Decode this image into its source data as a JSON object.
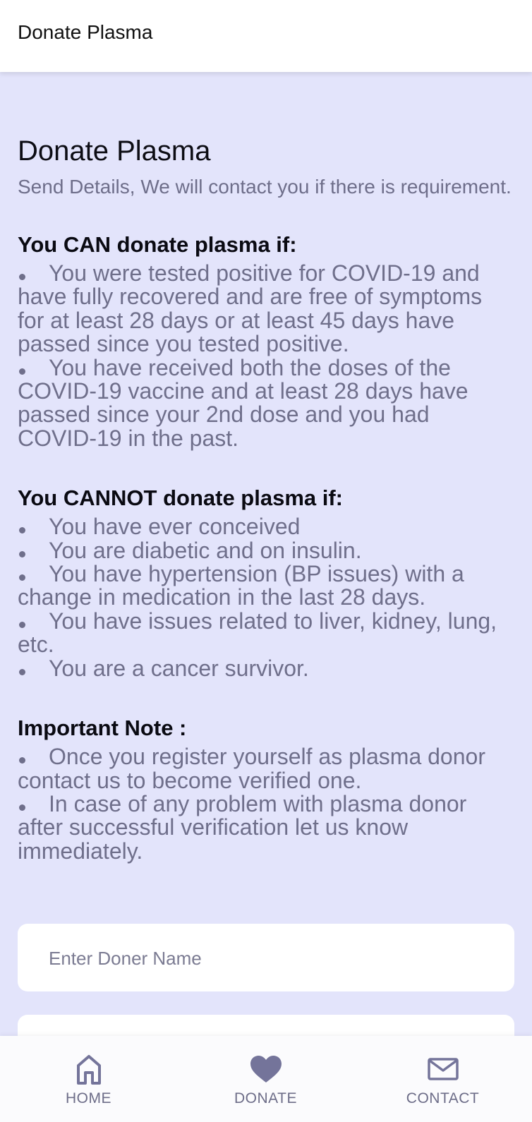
{
  "app_bar": {
    "title": "Donate Plasma"
  },
  "main": {
    "title": "Donate Plasma",
    "subtitle": "Send Details, We will contact you if there is requirement.",
    "sections": [
      {
        "heading": "You CAN donate plasma if:",
        "items": [
          "You were tested positive for COVID-19 and have fully recovered and are free of symptoms for at least 28 days or at least 45 days have passed since you tested positive.",
          "You have received both the doses of the COVID-19 vaccine and at least 28 days have passed since your 2nd dose and you had COVID-19 in the past."
        ]
      },
      {
        "heading": "You CANNOT donate plasma if:",
        "items": [
          "You have ever conceived",
          "You are diabetic and on insulin.",
          "You have hypertension (BP issues) with a change in medication in the last 28 days.",
          "You have issues related to liver, kidney, lung, etc.",
          "You are a cancer survivor."
        ]
      },
      {
        "heading": "Important Note :",
        "items": [
          "Once you register yourself as plasma donor contact us to become verified one.",
          "In case of any problem with plasma donor after successful verification let us know immediately."
        ]
      }
    ]
  },
  "form": {
    "donor_name": {
      "value": "",
      "placeholder": "Enter Doner Name"
    }
  },
  "bottom_nav": {
    "items": [
      {
        "label": "HOME",
        "icon": "home-icon"
      },
      {
        "label": "DONATE",
        "icon": "heart-icon"
      },
      {
        "label": "CONTACT",
        "icon": "mail-icon"
      }
    ]
  },
  "colors": {
    "background": "#e3e4fb",
    "text_muted": "#6f6f8b",
    "nav_icon": "#74749a"
  }
}
